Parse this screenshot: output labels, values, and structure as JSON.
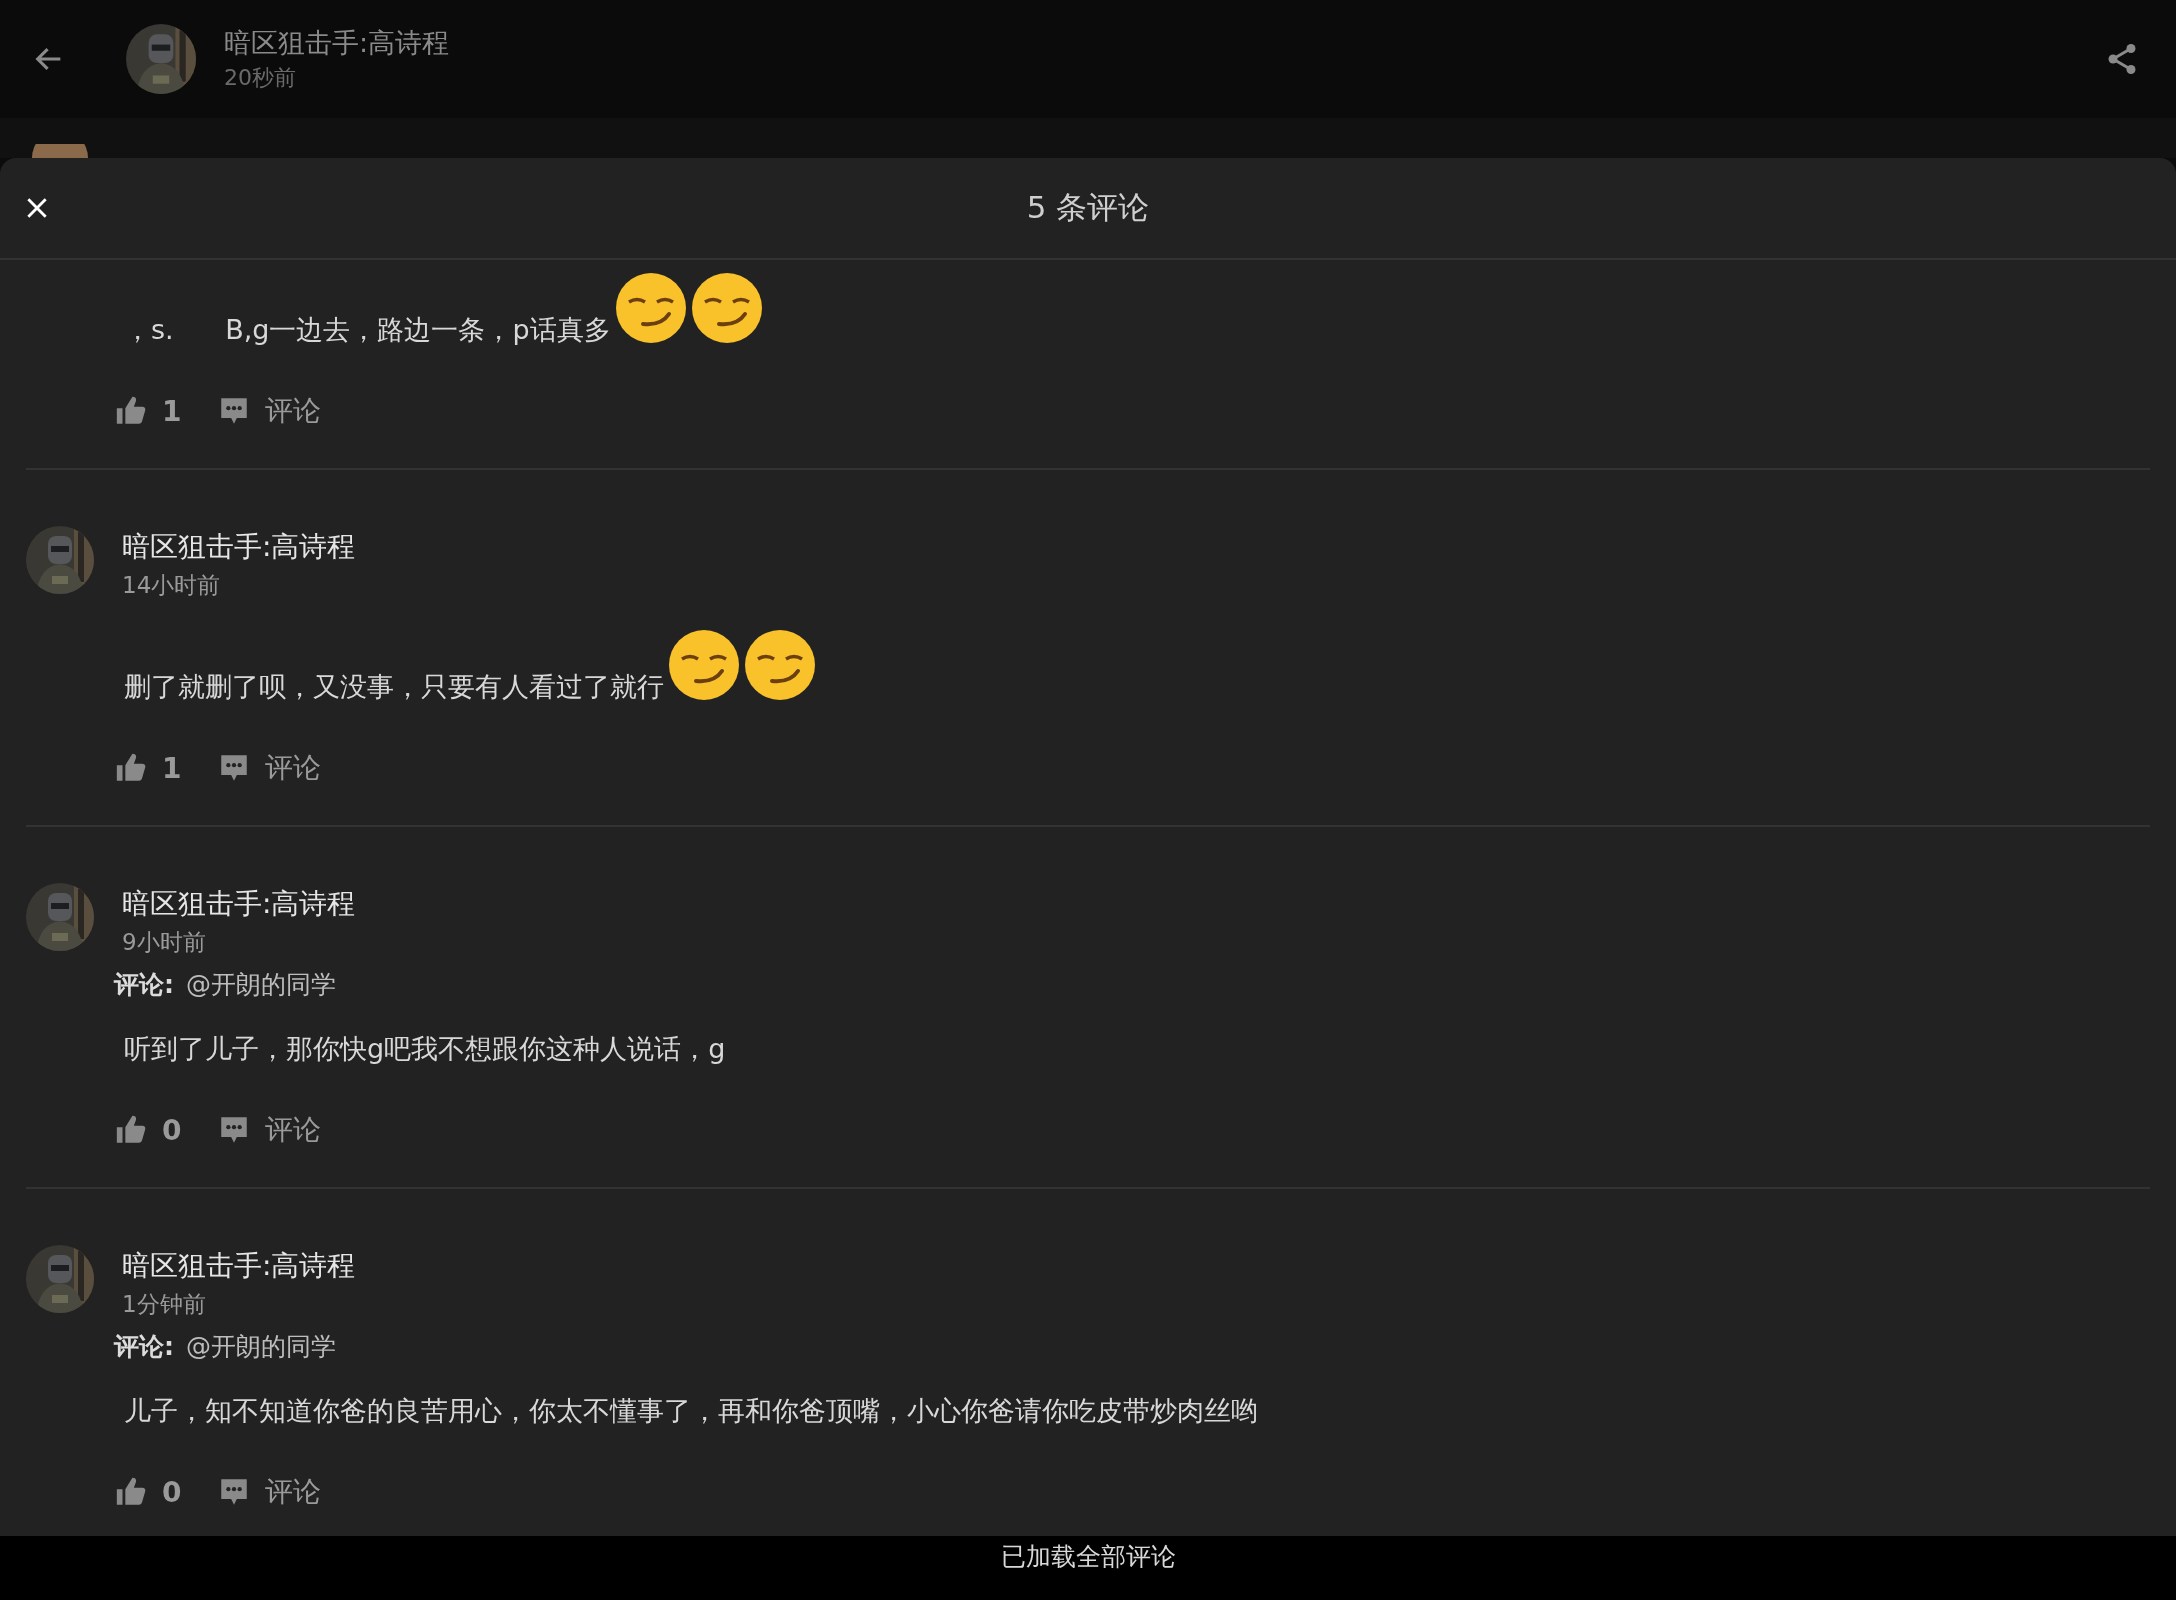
{
  "post_header": {
    "author": "暗区狙击手:高诗程",
    "time": "20秒前"
  },
  "comments_sheet": {
    "title": "5 条评论",
    "comments": [
      {
        "text": "，s.      B,g一边去，路边一条，p话真多",
        "emojis": [
          {
            "kind": "smirk"
          },
          {
            "kind": "smirk"
          }
        ],
        "likes": "1",
        "reply_label": "评论"
      },
      {
        "author": "暗区狙击手:高诗程",
        "time": "14小时前",
        "text": "删了就删了呗，又没事，只要有人看过了就行",
        "emojis": [
          {
            "kind": "smirk"
          },
          {
            "kind": "smirk"
          }
        ],
        "likes": "1",
        "reply_label": "评论"
      },
      {
        "author": "暗区狙击手:高诗程",
        "time": "9小时前",
        "reply_to_label": "评论:",
        "reply_to": "@开朗的同学",
        "text": "听到了儿子，那你快g吧我不想跟你这种人说话，g",
        "likes": "0",
        "reply_label": "评论"
      },
      {
        "author": "暗区狙击手:高诗程",
        "time": "1分钟前",
        "reply_to_label": "评论:",
        "reply_to": "@开朗的同学",
        "text": "儿子，知不知道你爸的良苦用心，你太不懂事了，再和你爸顶嘴，小心你爸请你吃皮带炒肉丝哟",
        "likes": "0",
        "reply_label": "评论"
      }
    ]
  },
  "footer": {
    "text": "已加载全部评论"
  }
}
